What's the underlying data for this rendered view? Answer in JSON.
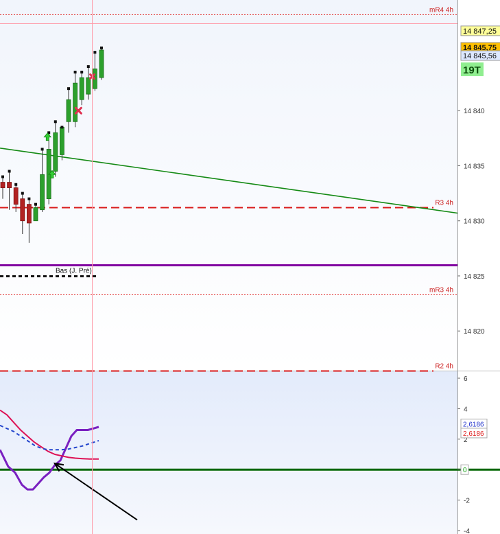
{
  "chart_data": [
    {
      "type": "candlestick",
      "panel": "price",
      "y_ticks": [
        "14 840",
        "14 835",
        "14 830",
        "14 825",
        "14 820"
      ],
      "y_tick_values": [
        14840,
        14835,
        14830,
        14825,
        14820
      ],
      "ylim": [
        14816.4,
        14848.8
      ],
      "badges": [
        {
          "label": "14 847,25",
          "value": 14847.25,
          "fill": "#ffff99",
          "stroke": "#999999",
          "bold": false
        },
        {
          "label": "14 845,75",
          "value": 14845.75,
          "fill": "#ffc000",
          "stroke": "#999999",
          "bold": true
        },
        {
          "label": "14 845,56",
          "value": 14845.0,
          "fill": "#dde8ff",
          "stroke": "#999999",
          "bold": false
        }
      ],
      "timer_label": "19T",
      "levels": [
        {
          "label": "mR4 4h",
          "value": 14848.75,
          "style": "dotted-red"
        },
        {
          "label": "R3 4h",
          "value": 14831.25,
          "style": "dashed-red"
        },
        {
          "label": "mR3 4h",
          "value": 14823.3,
          "style": "dotted-red"
        },
        {
          "label": "R2 4h",
          "value": 14816.4,
          "style": "dashed-red"
        },
        {
          "label": "",
          "value": 14826.0,
          "style": "purple"
        },
        {
          "label": "Bas (J. Pré)",
          "value": 14825.0,
          "style": "black-dashed"
        }
      ],
      "trendline": {
        "start": 14836.6,
        "end": 14830.7
      },
      "candles": [
        {
          "o": 14833.5,
          "h": 14834.0,
          "l": 14832.0,
          "c": 14833.0
        },
        {
          "o": 14833.5,
          "h": 14834.5,
          "l": 14831.0,
          "c": 14833.0
        },
        {
          "o": 14833.0,
          "h": 14833.3,
          "l": 14830.8,
          "c": 14831.5
        },
        {
          "o": 14832.0,
          "h": 14832.5,
          "l": 14828.8,
          "c": 14830.0
        },
        {
          "o": 14831.5,
          "h": 14832.0,
          "l": 14828.0,
          "c": 14829.8
        },
        {
          "o": 14830.0,
          "h": 14831.5,
          "l": 14830.0,
          "c": 14831.2
        },
        {
          "o": 14831.0,
          "h": 14836.5,
          "l": 14830.8,
          "c": 14834.2
        },
        {
          "o": 14832.0,
          "h": 14838.0,
          "l": 14831.5,
          "c": 14836.5
        },
        {
          "o": 14834.5,
          "h": 14839.0,
          "l": 14834.0,
          "c": 14838.0
        },
        {
          "o": 14836.0,
          "h": 14838.5,
          "l": 14835.5,
          "c": 14838.5
        },
        {
          "o": 14839.0,
          "h": 14842.0,
          "l": 14838.0,
          "c": 14841.0
        },
        {
          "o": 14839.0,
          "h": 14843.5,
          "l": 14838.5,
          "c": 14842.5
        },
        {
          "o": 14841.0,
          "h": 14843.5,
          "l": 14840.5,
          "c": 14843.0
        },
        {
          "o": 14841.5,
          "h": 14844.0,
          "l": 14841.0,
          "c": 14843.0
        },
        {
          "o": 14842.0,
          "h": 14845.3,
          "l": 14841.8,
          "c": 14843.8
        },
        {
          "o": 14843.0,
          "h": 14845.7,
          "l": 14842.8,
          "c": 14845.5
        }
      ],
      "marks": [
        {
          "kind": "cross",
          "candle": 11.5,
          "value": 14840.0
        },
        {
          "kind": "up-arrow",
          "candle": 7.5,
          "value": 14834.2
        },
        {
          "kind": "up-arrow",
          "candle": 6.8,
          "value": 14837.6
        },
        {
          "kind": "cross-small",
          "candle": 13.6,
          "value": 14843.1
        }
      ],
      "colors": {
        "up": "#2ca02c",
        "down": "#b22222"
      }
    },
    {
      "type": "line",
      "panel": "oscillator",
      "y_ticks": [
        "6",
        "4",
        "2",
        "0",
        "-2",
        "-4"
      ],
      "y_tick_values": [
        6,
        4,
        2,
        0,
        -2,
        -4
      ],
      "ylim": [
        -4,
        6
      ],
      "badges": [
        {
          "label": "2,6186",
          "value": 3.0,
          "color": "#2233cc"
        },
        {
          "label": "2,6186",
          "value": 2.4,
          "color": "#dd2222"
        },
        {
          "label": "0",
          "value": 0,
          "color": "#009900"
        }
      ],
      "series": [
        {
          "color": "#7a20c0",
          "style": "solid",
          "x": [
            0,
            12,
            22,
            32,
            40,
            48,
            56,
            64,
            72,
            80,
            88,
            96,
            104,
            112,
            120,
            128,
            136,
            144
          ],
          "values": [
            1.3,
            0.2,
            -0.2,
            -1.0,
            -1.3,
            -1.3,
            -0.9,
            -0.5,
            -0.2,
            0.3,
            0.6,
            1.4,
            2.2,
            2.6,
            2.6,
            2.6,
            2.7,
            2.8
          ]
        },
        {
          "color": "#dd1155",
          "style": "solid",
          "x": [
            0,
            10,
            20,
            30,
            40,
            50,
            60,
            70,
            80,
            90,
            100,
            110,
            120,
            130,
            144
          ],
          "values": [
            3.9,
            3.6,
            3.1,
            2.6,
            2.2,
            1.8,
            1.5,
            1.2,
            1.0,
            0.9,
            0.8,
            0.75,
            0.72,
            0.7,
            0.7
          ]
        },
        {
          "color": "#2244cc",
          "style": "dashed",
          "x": [
            0,
            10,
            20,
            30,
            40,
            50,
            60,
            70,
            80,
            90,
            100,
            110,
            120,
            130,
            144
          ],
          "values": [
            2.9,
            2.7,
            2.5,
            2.2,
            1.9,
            1.6,
            1.4,
            1.3,
            1.3,
            1.3,
            1.35,
            1.45,
            1.55,
            1.7,
            1.9
          ]
        }
      ],
      "zero_line_color": "#006600",
      "arrow": {
        "from_x": 200,
        "from_value": -3.3,
        "to_x": 80,
        "to_value": 0.4
      }
    }
  ]
}
